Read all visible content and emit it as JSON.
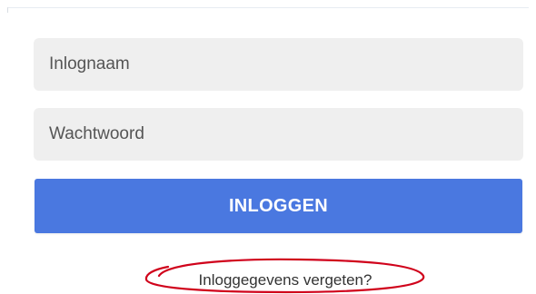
{
  "login_form": {
    "username_placeholder": "Inlognaam",
    "password_placeholder": "Wachtwoord",
    "submit_label": "INLOGGEN",
    "forgot_label": "Inloggegevens vergeten?"
  },
  "colors": {
    "field_background": "#efefef",
    "button_background": "#4a78e0",
    "annotation_ellipse": "#d0021b"
  }
}
